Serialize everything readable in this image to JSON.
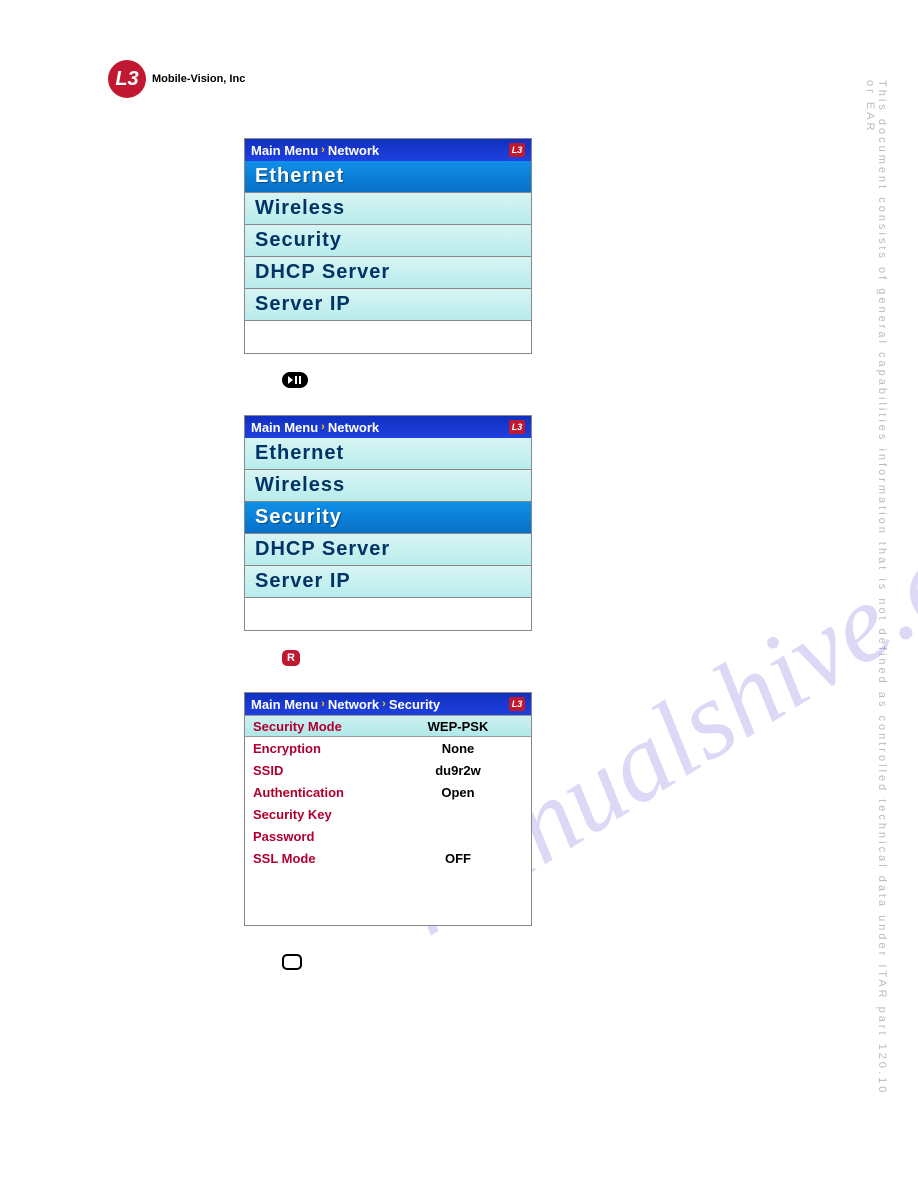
{
  "header": {
    "logo_text": "L3",
    "company": "Mobile-Vision, Inc"
  },
  "side_disclaimer": "This document consists of general capabilities information that is not defined as controlled technical data under ITAR part 120.10 or EAR",
  "watermark": "manualshive.com",
  "screen1": {
    "breadcrumb": [
      "Main Menu",
      "Network"
    ],
    "items": [
      "Ethernet",
      "Wireless",
      "Security",
      "DHCP Server",
      "Server IP"
    ],
    "selected_index": 0
  },
  "screen2": {
    "breadcrumb": [
      "Main Menu",
      "Network"
    ],
    "items": [
      "Ethernet",
      "Wireless",
      "Security",
      "DHCP Server",
      "Server IP"
    ],
    "selected_index": 2
  },
  "screen3": {
    "breadcrumb": [
      "Main Menu",
      "Network",
      "Security"
    ],
    "rows": [
      {
        "label": "Security Mode",
        "value": "WEP-PSK",
        "selected": true
      },
      {
        "label": "Encryption",
        "value": "None",
        "selected": false
      },
      {
        "label": "SSID",
        "value": "du9r2w",
        "selected": false
      },
      {
        "label": "Authentication",
        "value": "Open",
        "selected": false
      },
      {
        "label": "Security Key",
        "value": "",
        "selected": false
      },
      {
        "label": "Password",
        "value": "",
        "selected": false
      },
      {
        "label": "SSL Mode",
        "value": "OFF",
        "selected": false
      }
    ]
  },
  "icons": {
    "playpause": "▶||",
    "r": "R",
    "titlebar_logo": "L3"
  }
}
